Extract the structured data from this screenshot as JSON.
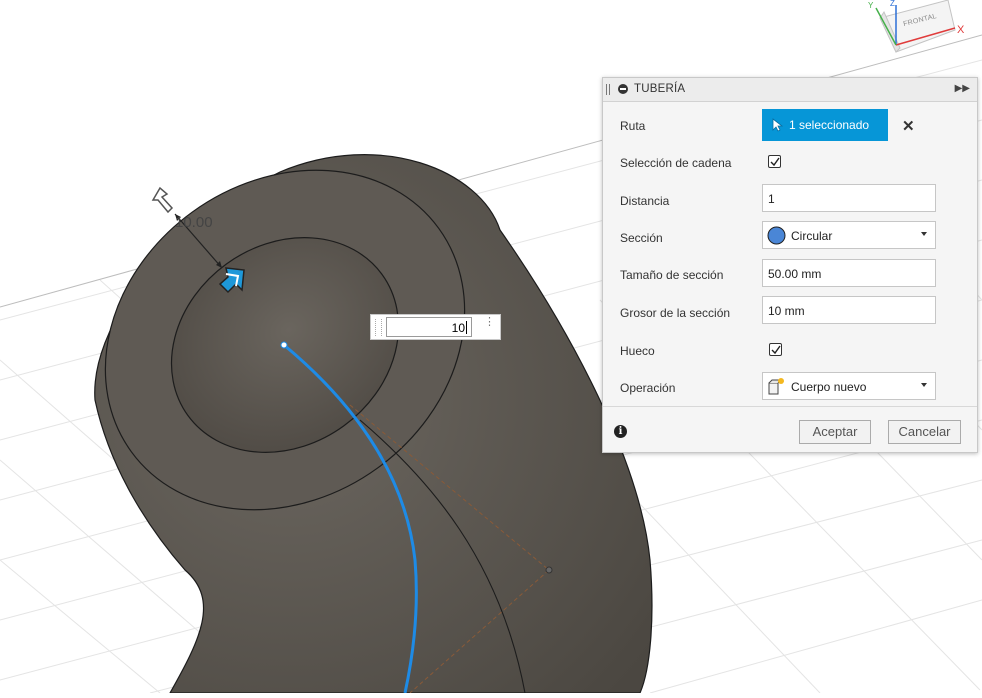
{
  "dialog": {
    "title": "TUBERÍA",
    "rows": {
      "ruta": {
        "label": "Ruta",
        "button": "1 seleccionado"
      },
      "chain": {
        "label": "Selección de cadena",
        "checked": true
      },
      "distance": {
        "label": "Distancia",
        "value": "1"
      },
      "section": {
        "label": "Sección",
        "value": "Circular"
      },
      "section_size": {
        "label": "Tamaño de sección",
        "value": "50.00 mm"
      },
      "section_thickness": {
        "label": "Grosor de la sección",
        "value": "10 mm"
      },
      "hollow": {
        "label": "Hueco",
        "checked": true
      },
      "operation": {
        "label": "Operación",
        "value": "Cuerpo nuevo"
      }
    },
    "ok_label": "Aceptar",
    "cancel_label": "Cancelar",
    "info_glyph": "i"
  },
  "viewport": {
    "dimension_value": "10.00",
    "inline_input_value": "10",
    "viewcube_face": "FRONTAL",
    "axis_x": "X",
    "axis_y": "Y",
    "axis_z": "Z"
  },
  "icons": [
    "cursor-select-icon",
    "close-icon",
    "circle-section-icon",
    "new-body-icon",
    "dropdown-caret-icon",
    "info-icon",
    "checkmark-icon",
    "drag-arrow-icon"
  ],
  "colors": {
    "accent": "#0696d7",
    "path_blue": "#1e8be6",
    "body": "#5b5650",
    "annotation_red": "#e0261e"
  }
}
